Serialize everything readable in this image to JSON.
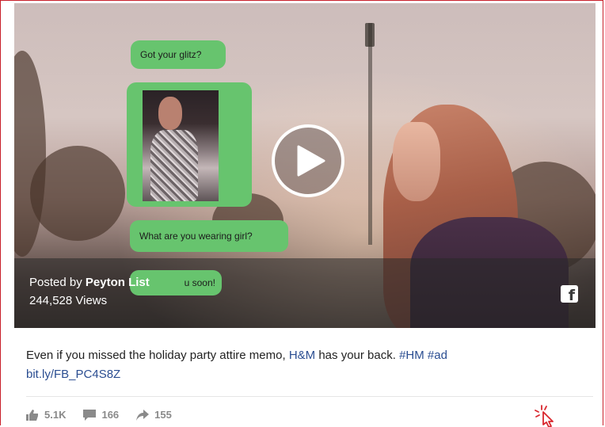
{
  "video": {
    "chat": {
      "bubble1": "Got your glitz?",
      "bubble3": "What are you wearing girl?",
      "bubble4": "u soon!"
    },
    "posted_prefix": "Posted by ",
    "author": "Peyton List",
    "views": "244,528 Views",
    "fb_glyph": "f"
  },
  "post": {
    "caption_text": "Even if you missed the holiday party attire memo, ",
    "brand_link": "H&M",
    "caption_text2": " has your back. ",
    "hashtag1": "#HM",
    "hashtag2": "#ad",
    "short_link": "bit.ly/FB_PC4S8Z"
  },
  "stats": {
    "likes": "5.1K",
    "comments": "166",
    "shares": "155"
  },
  "colors": {
    "bubble": "#67c46e",
    "link": "#2a4d91",
    "frame_border": "#c8202a",
    "cursor": "#d9272e"
  },
  "icons": {
    "likes": "thumbs-up-icon",
    "comments": "comment-icon",
    "shares": "share-arrow-icon",
    "facebook": "facebook-icon",
    "play": "play-icon"
  }
}
